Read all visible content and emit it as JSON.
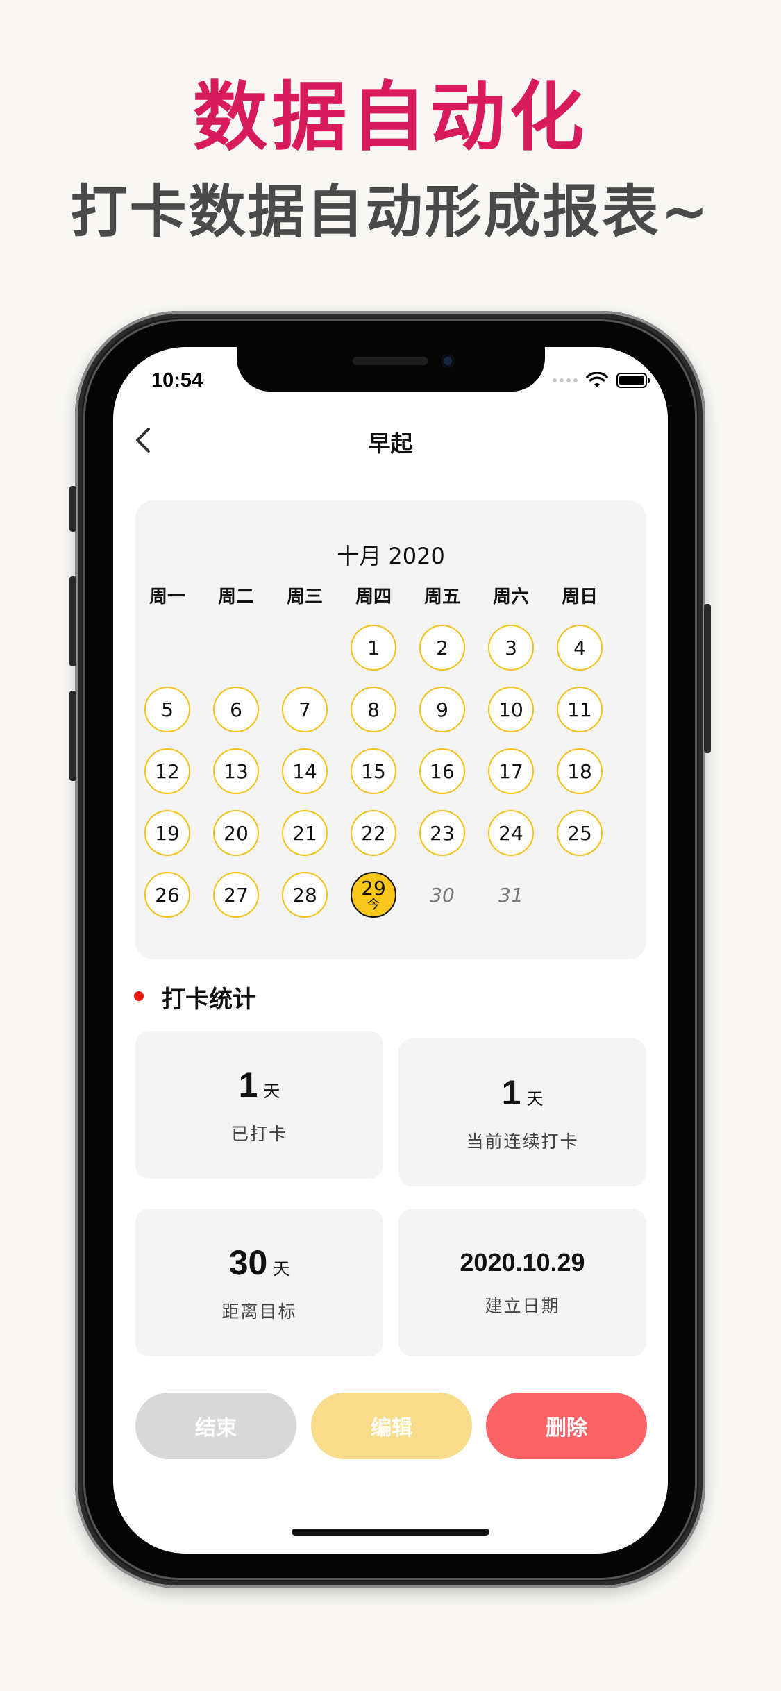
{
  "banner": {
    "title": "数据自动化",
    "subtitle": "打卡数据自动形成报表~"
  },
  "status_bar": {
    "time": "10:54"
  },
  "nav": {
    "title": "早起",
    "back_icon": "chevron-left-icon"
  },
  "calendar": {
    "month_label": "十月 2020",
    "weekdays": [
      "周一",
      "周二",
      "周三",
      "周四",
      "周五",
      "周六",
      "周日"
    ],
    "days": [
      {
        "label": "1",
        "state": "checked"
      },
      {
        "label": "2",
        "state": "checked"
      },
      {
        "label": "3",
        "state": "checked"
      },
      {
        "label": "4",
        "state": "checked"
      },
      {
        "label": "5",
        "state": "checked"
      },
      {
        "label": "6",
        "state": "checked"
      },
      {
        "label": "7",
        "state": "checked"
      },
      {
        "label": "8",
        "state": "checked"
      },
      {
        "label": "9",
        "state": "checked"
      },
      {
        "label": "10",
        "state": "checked"
      },
      {
        "label": "11",
        "state": "checked"
      },
      {
        "label": "12",
        "state": "checked"
      },
      {
        "label": "13",
        "state": "checked"
      },
      {
        "label": "14",
        "state": "checked"
      },
      {
        "label": "15",
        "state": "checked"
      },
      {
        "label": "16",
        "state": "checked"
      },
      {
        "label": "17",
        "state": "checked"
      },
      {
        "label": "18",
        "state": "checked"
      },
      {
        "label": "19",
        "state": "checked"
      },
      {
        "label": "20",
        "state": "checked"
      },
      {
        "label": "21",
        "state": "checked"
      },
      {
        "label": "22",
        "state": "checked"
      },
      {
        "label": "23",
        "state": "checked"
      },
      {
        "label": "24",
        "state": "checked"
      },
      {
        "label": "25",
        "state": "checked"
      },
      {
        "label": "26",
        "state": "checked"
      },
      {
        "label": "27",
        "state": "checked"
      },
      {
        "label": "28",
        "state": "checked"
      },
      {
        "label": "29",
        "state": "today",
        "sub": "今"
      },
      {
        "label": "30",
        "state": "future"
      },
      {
        "label": "31",
        "state": "future"
      }
    ],
    "colors": {
      "ring": "#f2c21b",
      "today_fill": "#f8c51a"
    }
  },
  "stats": {
    "section_title": "打卡统计",
    "checked": {
      "value": "1",
      "unit": "天",
      "label": "已打卡"
    },
    "streak": {
      "value": "1",
      "unit": "天",
      "label": "当前连续打卡"
    },
    "remaining": {
      "value": "30",
      "unit": "天",
      "label": "距离目标"
    },
    "created": {
      "value": "2020.10.29",
      "label": "建立日期"
    }
  },
  "actions": {
    "end": "结束",
    "edit": "编辑",
    "delete": "删除"
  },
  "colors": {
    "banner_title": "#d81b5c",
    "delete": "#fb6466",
    "edit": "#f8dc8c",
    "end": "#d8d8d8",
    "dot": "#e8180f"
  }
}
